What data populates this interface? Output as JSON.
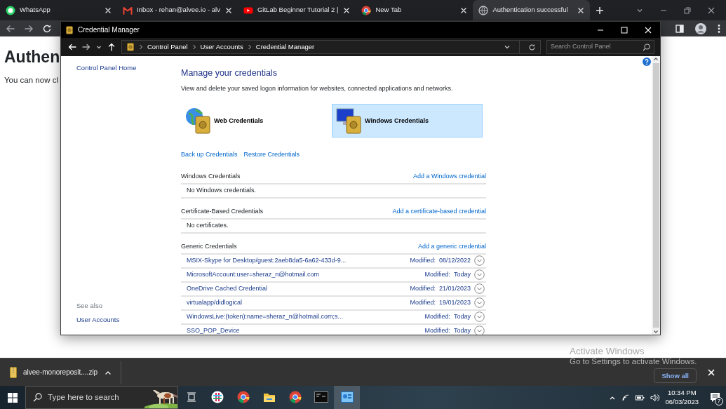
{
  "browser": {
    "tabs": [
      {
        "kind": "chat",
        "title": "WhatsApp",
        "selected": false
      },
      {
        "kind": "mail",
        "title": "Inbox - rehan@alvee.io - alv",
        "selected": false
      },
      {
        "kind": "video",
        "title": "GitLab Beginner Tutorial 2 |",
        "selected": false
      },
      {
        "kind": "browser",
        "title": "New Tab",
        "selected": false
      },
      {
        "kind": "globe",
        "title": "Authentication successful",
        "selected": true
      }
    ]
  },
  "page": {
    "heading": "Authen",
    "text": "You can now cl"
  },
  "credential_window": {
    "title": "Credential Manager",
    "breadcrumb": [
      "Control Panel",
      "User Accounts",
      "Credential Manager"
    ],
    "search": {
      "placeholder": "Search Control Panel"
    },
    "sidebar": {
      "home_link": "Control Panel Home",
      "see_also": "See also",
      "links": [
        "User Accounts"
      ]
    },
    "heading": "Manage your credentials",
    "description": "View and delete your saved logon information for websites, connected applications and networks.",
    "tiles": [
      {
        "kind": "web",
        "label": "Web Credentials",
        "selected": false
      },
      {
        "kind": "windows",
        "label": "Windows Credentials",
        "selected": true
      }
    ],
    "actions": [
      "Back up Credentials",
      "Restore Credentials"
    ],
    "sections": [
      {
        "title": "Windows Credentials",
        "add_link": "Add a Windows credential",
        "empty_text": "No Windows credentials."
      },
      {
        "title": "Certificate-Based Credentials",
        "add_link": "Add a certificate-based credential",
        "empty_text": "No certificates."
      },
      {
        "title": "Generic Credentials",
        "add_link": "Add a generic credential",
        "items": [
          {
            "name": "MSIX-Skype for Desktop/guest:2aeb8da5-6a62-433d-9...",
            "modified_label": "Modified:",
            "date": "08/12/2022"
          },
          {
            "name": "MicrosoftAccount:user=sheraz_n@hotmail.com",
            "modified_label": "Modified:",
            "date": "Today"
          },
          {
            "name": "OneDrive Cached Credential",
            "modified_label": "Modified:",
            "date": "21/01/2023"
          },
          {
            "name": "virtualapp/didlogical",
            "modified_label": "Modified:",
            "date": "19/01/2023"
          },
          {
            "name": "WindowsLive:(token):name=sheraz_n@hotmail.com;s...",
            "modified_label": "Modified:",
            "date": "Today"
          },
          {
            "name": "SSO_POP_Device",
            "modified_label": "Modified:",
            "date": "Today"
          }
        ]
      }
    ]
  },
  "downloads": {
    "file": "alvee-monoreposit....zip",
    "show_all": "Show all"
  },
  "activation": {
    "title": "Activate Windows",
    "text": "Go to Settings to activate Windows."
  },
  "taskbar": {
    "search": {
      "placeholder": "Type here to search"
    },
    "apps": [
      {
        "kind": "chat",
        "selected": false
      },
      {
        "kind": "browser",
        "selected": false
      },
      {
        "kind": "folder",
        "selected": false
      },
      {
        "kind": "browser",
        "selected": false
      },
      {
        "kind": "terminal",
        "selected": false
      },
      {
        "kind": "control-panel",
        "selected": true
      }
    ],
    "tray": {
      "time": "10:34 PM",
      "date": "06/03/2023",
      "notification_count": "7"
    }
  }
}
